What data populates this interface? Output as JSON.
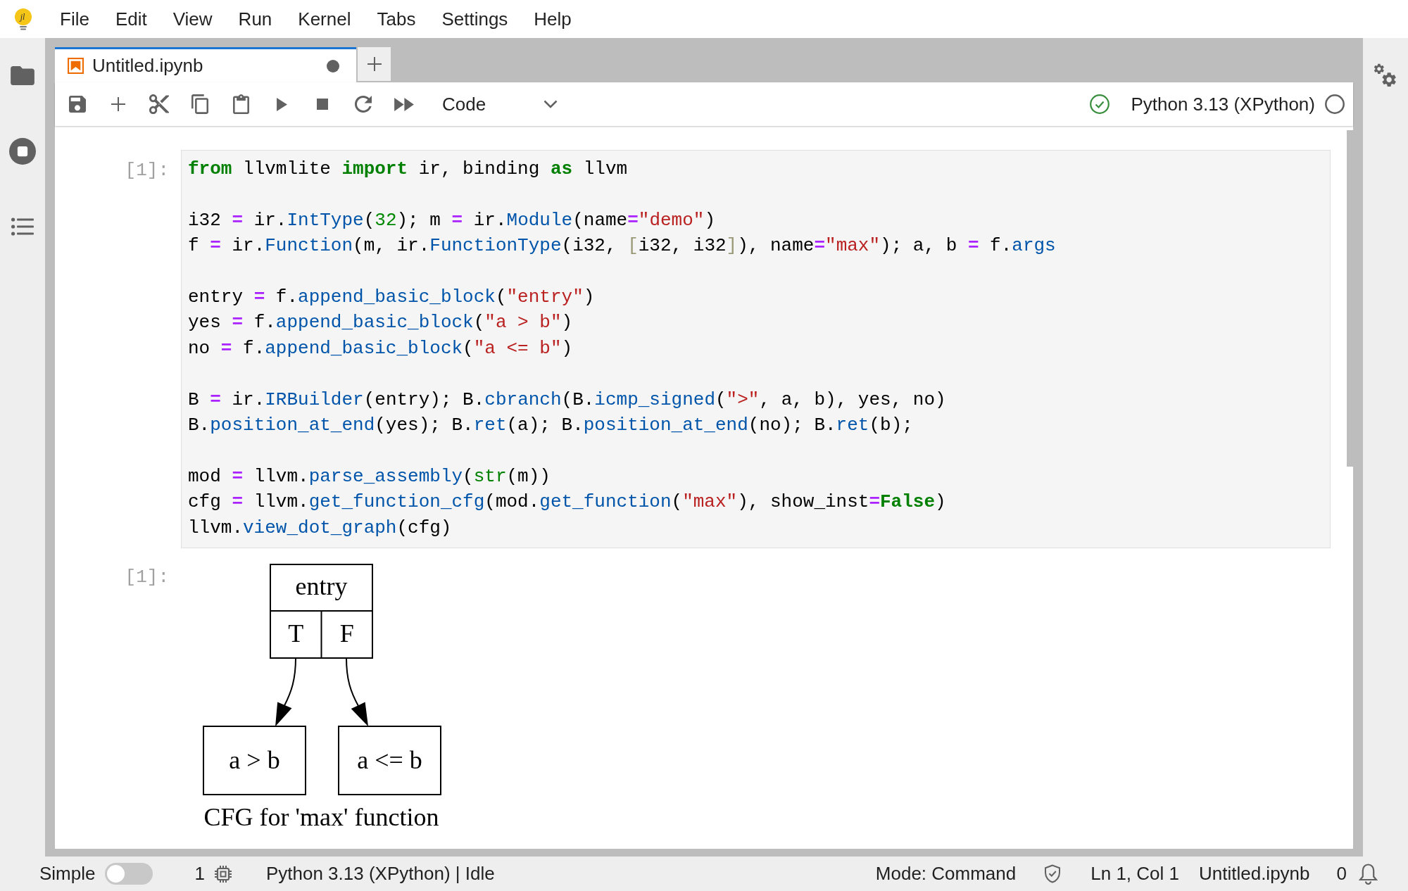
{
  "menu": {
    "logo": "jl",
    "items": [
      "File",
      "Edit",
      "View",
      "Run",
      "Kernel",
      "Tabs",
      "Settings",
      "Help"
    ]
  },
  "tabs": [
    {
      "title": "Untitled.ipynb",
      "selected": true,
      "dirty": true
    }
  ],
  "toolbar": {
    "cell_type": "Code",
    "kernel": {
      "name": "Python 3.13 (XPython)",
      "busy": false
    }
  },
  "cells": [
    {
      "prompt": "[1]:",
      "blocks": [
        {
          "lines": [
            {
              "tokens": [
                {
                  "kind": "keyword",
                  "text": "from"
                },
                {
                  "kind": "text",
                  "text": " llvmlite "
                },
                {
                  "kind": "keyword",
                  "text": "import"
                },
                {
                  "kind": "text",
                  "text": " ir, binding "
                },
                {
                  "kind": "keyword",
                  "text": "as"
                },
                {
                  "kind": "text",
                  "text": " llvm"
                }
              ]
            }
          ]
        },
        {
          "lines": [
            {
              "tokens": [
                {
                  "kind": "text",
                  "text": "i32 "
                },
                {
                  "kind": "operator",
                  "text": "="
                },
                {
                  "kind": "text",
                  "text": " ir."
                },
                {
                  "kind": "property",
                  "text": "IntType"
                },
                {
                  "kind": "text",
                  "text": "("
                },
                {
                  "kind": "number",
                  "text": "32"
                },
                {
                  "kind": "text",
                  "text": "); m "
                },
                {
                  "kind": "operator",
                  "text": "="
                },
                {
                  "kind": "text",
                  "text": " ir."
                },
                {
                  "kind": "property",
                  "text": "Module"
                },
                {
                  "kind": "text",
                  "text": "(name"
                },
                {
                  "kind": "operator",
                  "text": "="
                },
                {
                  "kind": "string",
                  "text": "\"demo\""
                },
                {
                  "kind": "text",
                  "text": ")"
                }
              ]
            },
            {
              "tokens": [
                {
                  "kind": "text",
                  "text": "f "
                },
                {
                  "kind": "operator",
                  "text": "="
                },
                {
                  "kind": "text",
                  "text": " ir."
                },
                {
                  "kind": "property",
                  "text": "Function"
                },
                {
                  "kind": "text",
                  "text": "(m, ir."
                },
                {
                  "kind": "property",
                  "text": "FunctionType"
                },
                {
                  "kind": "text",
                  "text": "(i32, "
                },
                {
                  "kind": "bracket",
                  "text": "["
                },
                {
                  "kind": "text",
                  "text": "i32, i32"
                },
                {
                  "kind": "bracket",
                  "text": "]"
                },
                {
                  "kind": "text",
                  "text": "), name"
                },
                {
                  "kind": "operator",
                  "text": "="
                },
                {
                  "kind": "string",
                  "text": "\"max\""
                },
                {
                  "kind": "text",
                  "text": "); a, b "
                },
                {
                  "kind": "operator",
                  "text": "="
                },
                {
                  "kind": "text",
                  "text": " f."
                },
                {
                  "kind": "property",
                  "text": "args"
                }
              ]
            }
          ]
        },
        {
          "lines": [
            {
              "tokens": [
                {
                  "kind": "text",
                  "text": "entry "
                },
                {
                  "kind": "operator",
                  "text": "="
                },
                {
                  "kind": "text",
                  "text": " f."
                },
                {
                  "kind": "property",
                  "text": "append_basic_block"
                },
                {
                  "kind": "text",
                  "text": "("
                },
                {
                  "kind": "string",
                  "text": "\"entry\""
                },
                {
                  "kind": "text",
                  "text": ")"
                }
              ]
            },
            {
              "tokens": [
                {
                  "kind": "text",
                  "text": "yes "
                },
                {
                  "kind": "operator",
                  "text": "="
                },
                {
                  "kind": "text",
                  "text": " f."
                },
                {
                  "kind": "property",
                  "text": "append_basic_block"
                },
                {
                  "kind": "text",
                  "text": "("
                },
                {
                  "kind": "string",
                  "text": "\"a > b\""
                },
                {
                  "kind": "text",
                  "text": ")"
                }
              ]
            },
            {
              "tokens": [
                {
                  "kind": "text",
                  "text": "no "
                },
                {
                  "kind": "operator",
                  "text": "="
                },
                {
                  "kind": "text",
                  "text": " f."
                },
                {
                  "kind": "property",
                  "text": "append_basic_block"
                },
                {
                  "kind": "text",
                  "text": "("
                },
                {
                  "kind": "string",
                  "text": "\"a <= b\""
                },
                {
                  "kind": "text",
                  "text": ")"
                }
              ]
            }
          ]
        },
        {
          "lines": [
            {
              "tokens": [
                {
                  "kind": "text",
                  "text": "B "
                },
                {
                  "kind": "operator",
                  "text": "="
                },
                {
                  "kind": "text",
                  "text": " ir."
                },
                {
                  "kind": "property",
                  "text": "IRBuilder"
                },
                {
                  "kind": "text",
                  "text": "(entry); B."
                },
                {
                  "kind": "property",
                  "text": "cbranch"
                },
                {
                  "kind": "text",
                  "text": "(B."
                },
                {
                  "kind": "property",
                  "text": "icmp_signed"
                },
                {
                  "kind": "text",
                  "text": "("
                },
                {
                  "kind": "string",
                  "text": "\">\""
                },
                {
                  "kind": "text",
                  "text": ", a, b), yes, no)"
                }
              ]
            },
            {
              "tokens": [
                {
                  "kind": "text",
                  "text": "B."
                },
                {
                  "kind": "property",
                  "text": "position_at_end"
                },
                {
                  "kind": "text",
                  "text": "(yes); B."
                },
                {
                  "kind": "property",
                  "text": "ret"
                },
                {
                  "kind": "text",
                  "text": "(a); B."
                },
                {
                  "kind": "property",
                  "text": "position_at_end"
                },
                {
                  "kind": "text",
                  "text": "(no); B."
                },
                {
                  "kind": "property",
                  "text": "ret"
                },
                {
                  "kind": "text",
                  "text": "(b);"
                }
              ]
            }
          ]
        },
        {
          "lines": [
            {
              "tokens": [
                {
                  "kind": "text",
                  "text": "mod "
                },
                {
                  "kind": "operator",
                  "text": "="
                },
                {
                  "kind": "text",
                  "text": " llvm."
                },
                {
                  "kind": "property",
                  "text": "parse_assembly"
                },
                {
                  "kind": "text",
                  "text": "("
                },
                {
                  "kind": "builtin",
                  "text": "str"
                },
                {
                  "kind": "text",
                  "text": "(m))"
                }
              ]
            },
            {
              "tokens": [
                {
                  "kind": "text",
                  "text": "cfg "
                },
                {
                  "kind": "operator",
                  "text": "="
                },
                {
                  "kind": "text",
                  "text": " llvm."
                },
                {
                  "kind": "property",
                  "text": "get_function_cfg"
                },
                {
                  "kind": "text",
                  "text": "(mod."
                },
                {
                  "kind": "property",
                  "text": "get_function"
                },
                {
                  "kind": "text",
                  "text": "("
                },
                {
                  "kind": "string",
                  "text": "\"max\""
                },
                {
                  "kind": "text",
                  "text": "), show_inst"
                },
                {
                  "kind": "operator",
                  "text": "="
                },
                {
                  "kind": "keyword",
                  "text": "False"
                },
                {
                  "kind": "text",
                  "text": ")"
                }
              ]
            },
            {
              "tokens": [
                {
                  "kind": "text",
                  "text": "llvm."
                },
                {
                  "kind": "property",
                  "text": "view_dot_graph"
                },
                {
                  "kind": "text",
                  "text": "(cfg)"
                }
              ]
            }
          ]
        }
      ],
      "output": {
        "prompt": "[1]:",
        "graph": {
          "entry": {
            "label": "entry",
            "branches": [
              {
                "label": "T",
                "target": "a > b"
              },
              {
                "label": "F",
                "target": "a <= b"
              }
            ]
          },
          "caption": "CFG for 'max' function"
        }
      }
    }
  ],
  "status_bar": {
    "simple_mode": {
      "label": "Simple",
      "on": false
    },
    "kernel_count": "1",
    "kernel_status": "Python 3.13 (XPython) | Idle",
    "mode": "Mode: Command",
    "position": "Ln 1, Col 1",
    "file": "Untitled.ipynb",
    "notifications": "0"
  }
}
